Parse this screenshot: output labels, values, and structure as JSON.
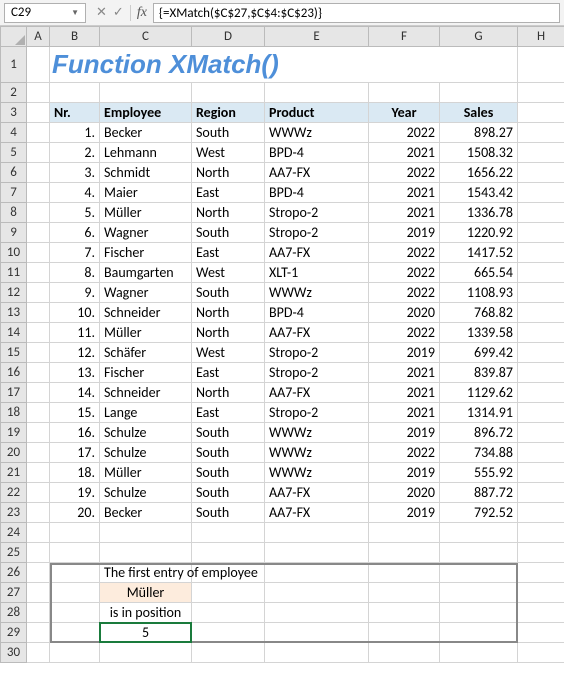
{
  "nameBox": "C29",
  "formula": "{=XMatch($C$27,$C$4:$C$23)}",
  "title": "Function XMatch()",
  "columns": [
    "A",
    "B",
    "C",
    "D",
    "E",
    "F",
    "G",
    "H"
  ],
  "headers": {
    "Nr": "Nr.",
    "Employee": "Employee",
    "Region": "Region",
    "Product": "Product",
    "Year": "Year",
    "Sales": "Sales"
  },
  "rows": [
    {
      "nr": "1.",
      "emp": "Becker",
      "reg": "South",
      "prod": "WWWz",
      "yr": "2022",
      "sales": "898.27"
    },
    {
      "nr": "2.",
      "emp": "Lehmann",
      "reg": "West",
      "prod": "BPD-4",
      "yr": "2021",
      "sales": "1508.32"
    },
    {
      "nr": "3.",
      "emp": "Schmidt",
      "reg": "North",
      "prod": "AA7-FX",
      "yr": "2022",
      "sales": "1656.22"
    },
    {
      "nr": "4.",
      "emp": "Maier",
      "reg": "East",
      "prod": "BPD-4",
      "yr": "2021",
      "sales": "1543.42"
    },
    {
      "nr": "5.",
      "emp": "Müller",
      "reg": "North",
      "prod": "Stropo-2",
      "yr": "2021",
      "sales": "1336.78"
    },
    {
      "nr": "6.",
      "emp": "Wagner",
      "reg": "South",
      "prod": "Stropo-2",
      "yr": "2019",
      "sales": "1220.92"
    },
    {
      "nr": "7.",
      "emp": "Fischer",
      "reg": "East",
      "prod": "AA7-FX",
      "yr": "2022",
      "sales": "1417.52"
    },
    {
      "nr": "8.",
      "emp": "Baumgarten",
      "reg": "West",
      "prod": "XLT-1",
      "yr": "2022",
      "sales": "665.54"
    },
    {
      "nr": "9.",
      "emp": "Wagner",
      "reg": "South",
      "prod": "WWWz",
      "yr": "2022",
      "sales": "1108.93"
    },
    {
      "nr": "10.",
      "emp": "Schneider",
      "reg": "North",
      "prod": "BPD-4",
      "yr": "2020",
      "sales": "768.82"
    },
    {
      "nr": "11.",
      "emp": "Müller",
      "reg": "North",
      "prod": "AA7-FX",
      "yr": "2022",
      "sales": "1339.58"
    },
    {
      "nr": "12.",
      "emp": "Schäfer",
      "reg": "West",
      "prod": "Stropo-2",
      "yr": "2019",
      "sales": "699.42"
    },
    {
      "nr": "13.",
      "emp": "Fischer",
      "reg": "East",
      "prod": "Stropo-2",
      "yr": "2021",
      "sales": "839.87"
    },
    {
      "nr": "14.",
      "emp": "Schneider",
      "reg": "North",
      "prod": "AA7-FX",
      "yr": "2021",
      "sales": "1129.62"
    },
    {
      "nr": "15.",
      "emp": "Lange",
      "reg": "East",
      "prod": "Stropo-2",
      "yr": "2021",
      "sales": "1314.91"
    },
    {
      "nr": "16.",
      "emp": "Schulze",
      "reg": "South",
      "prod": "WWWz",
      "yr": "2019",
      "sales": "896.72"
    },
    {
      "nr": "17.",
      "emp": "Schulze",
      "reg": "South",
      "prod": "WWWz",
      "yr": "2022",
      "sales": "734.88"
    },
    {
      "nr": "18.",
      "emp": "Müller",
      "reg": "South",
      "prod": "WWWz",
      "yr": "2019",
      "sales": "555.92"
    },
    {
      "nr": "19.",
      "emp": "Schulze",
      "reg": "South",
      "prod": "AA7-FX",
      "yr": "2020",
      "sales": "887.72"
    },
    {
      "nr": "20.",
      "emp": "Becker",
      "reg": "South",
      "prod": "AA7-FX",
      "yr": "2019",
      "sales": "792.52"
    }
  ],
  "summary": {
    "line1": "The first entry of employee",
    "name": "Müller",
    "line2": "is in position",
    "result": "5"
  }
}
